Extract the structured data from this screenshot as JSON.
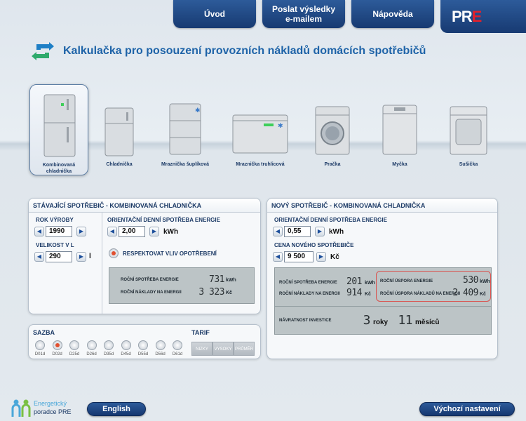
{
  "nav": {
    "uvod": "Úvod",
    "poslat_line1": "Poslat výsledky",
    "poslat_line2": "e-mailem",
    "napoveda": "Nápověda",
    "logo_p": "P",
    "logo_r": "R",
    "logo_e": "E"
  },
  "title": "Kalkulačka pro posouzení provozních nákladů domácích spotřebičů",
  "appliances": [
    {
      "label": "Kombinovaná chladnička",
      "selected": true
    },
    {
      "label": "Chladnička"
    },
    {
      "label": "Mraznička šuplíková"
    },
    {
      "label": "Mraznička truhlicová"
    },
    {
      "label": "Pračka"
    },
    {
      "label": "Myčka"
    },
    {
      "label": "Sušička"
    }
  ],
  "existing": {
    "header": "STÁVAJÍCÍ SPOTŘEBIČ - KOMBINOVANÁ CHLADNIČKA",
    "rok_label": "ROK VÝROBY",
    "rok_value": "1990",
    "velikost_label": "VELIKOST V L",
    "velikost_value": "290",
    "velikost_unit": "l",
    "spotreba_label": "ORIENTAČNÍ DENNÍ SPOTŘEBA ENERGIE",
    "spotreba_value": "2,00",
    "spotreba_unit": "kWh",
    "respektovat_label": "RESPEKTOVAT VLIV OPOTŘEBENÍ",
    "rocni_spotreba_label": "ROČNÍ SPOTŘEBA ENERGIE",
    "rocni_spotreba_value": "731",
    "rocni_spotreba_unit": "kWh",
    "rocni_naklady_label": "ROČNÍ NÁKLADY NA ENERGII",
    "rocni_naklady_value": "3 323",
    "rocni_naklady_unit": "Kč"
  },
  "new": {
    "header": "NOVÝ SPOTŘEBIČ - KOMBINOVANÁ CHLADNIČKA",
    "spotreba_label": "ORIENTAČNÍ DENNÍ SPOTŘEBA ENERGIE",
    "spotreba_value": "0,55",
    "spotreba_unit": "kWh",
    "cena_label": "CENA NOVÉHO SPOTŘEBIČE",
    "cena_value": "9 500",
    "cena_unit": "Kč",
    "rocni_spotreba_label": "ROČNÍ SPOTŘEBA ENERGIE",
    "rocni_spotreba_value": "201",
    "rocni_spotreba_unit": "kWh",
    "rocni_naklady_label": "ROČNÍ NÁKLADY NA ENERGII",
    "rocni_naklady_value": "914",
    "rocni_naklady_unit": "Kč",
    "uspora_energie_label": "ROČNÍ ÚSPORA ENERGIE",
    "uspora_energie_value": "530",
    "uspora_energie_unit": "kWh",
    "uspora_naklady_label": "ROČNÍ ÚSPORA NÁKLADŮ NA ENERGII",
    "uspora_naklady_value": "2 409",
    "uspora_naklady_unit": "Kč",
    "navratnost_label": "NÁVRATNOST INVESTICE",
    "navratnost_roky_value": "3",
    "navratnost_roky_unit": "roky",
    "navratnost_mesice_value": "11",
    "navratnost_mesice_unit": "měsíců"
  },
  "sazba": {
    "header": "SAZBA",
    "tarif_header": "TARIF",
    "options": [
      "D01d",
      "D02d",
      "D25d",
      "D26d",
      "D35d",
      "D45d",
      "D55d",
      "D56d",
      "D61d"
    ],
    "selected": "D02d",
    "tarifs": [
      "NIZKY",
      "VYSOKY",
      "PRŮMĚR"
    ]
  },
  "footer": {
    "brand_line1": "Energetický",
    "brand_line2": "poradce PRE",
    "english": "English",
    "reset": "Výchozí nastavení"
  },
  "colors": {
    "accent": "#1e63a8",
    "nav": "#1e4680",
    "brand_red": "#e4202b",
    "lcd": "#bcc4c6",
    "highlight_border": "#d9534f"
  }
}
